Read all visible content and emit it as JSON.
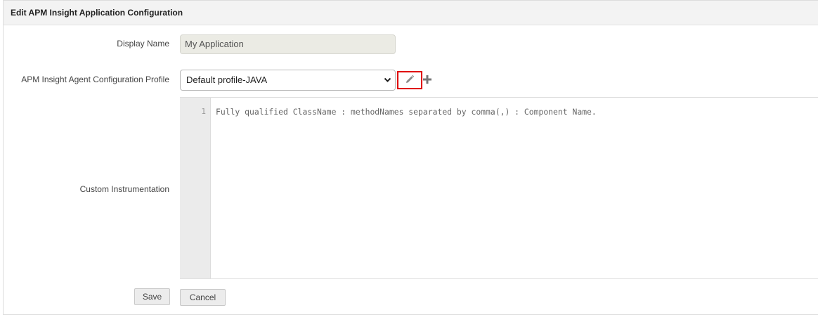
{
  "header": {
    "title": "Edit APM Insight Application Configuration"
  },
  "form": {
    "display_name": {
      "label": "Display Name",
      "value": "My Application"
    },
    "agent_profile": {
      "label": "APM Insight Agent Configuration Profile",
      "selected": "Default profile-JAVA",
      "edit_icon": "pencil-icon",
      "add_icon": "plus-icon"
    },
    "custom_instrumentation": {
      "label": "Custom Instrumentation",
      "lines": [
        {
          "number": "1",
          "text": "Fully qualified ClassName : methodNames separated by comma(,) : Component Name."
        }
      ]
    }
  },
  "actions": {
    "save_label": "Save",
    "cancel_label": "Cancel"
  },
  "colors": {
    "highlight": "#e00000",
    "disabled_input": "#ebebe4",
    "gutter": "#ebebeb"
  }
}
